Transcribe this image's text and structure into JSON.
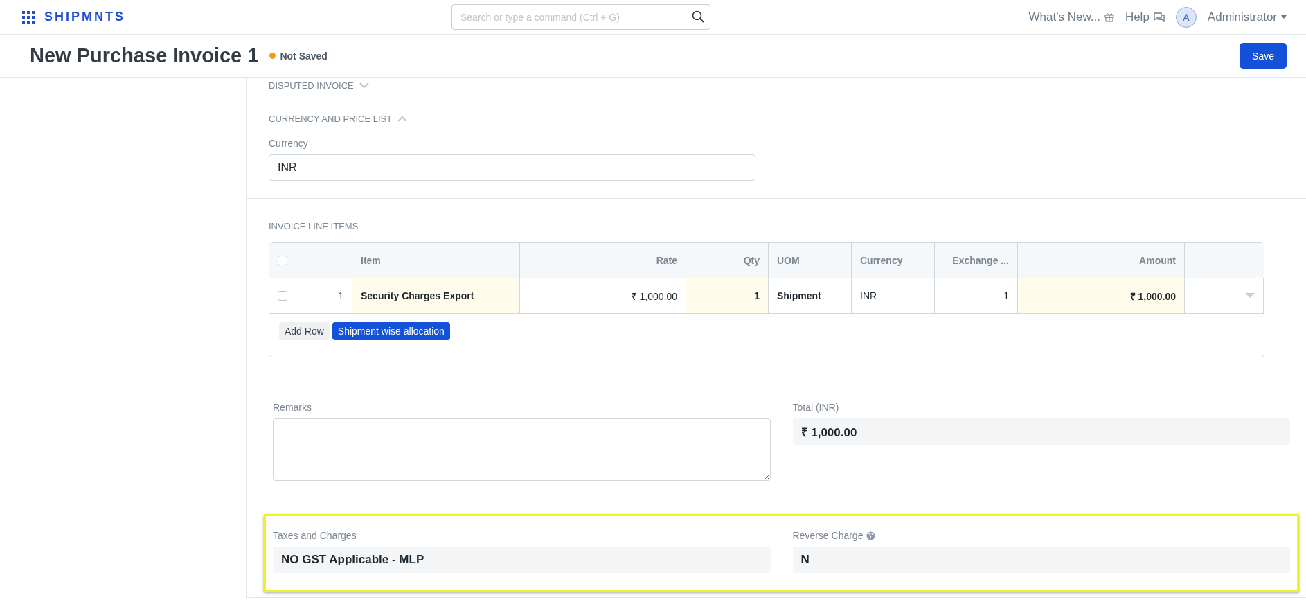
{
  "navbar": {
    "brand": "SHIPMNTS",
    "search": {
      "placeholder": "Search or type a command (Ctrl + G)"
    },
    "whats_new": "What's New...",
    "help": "Help",
    "user": {
      "initial": "A",
      "name": "Administrator"
    }
  },
  "page": {
    "title": "New Purchase Invoice 1",
    "status": "Not Saved",
    "save": "Save"
  },
  "sections": [
    {
      "kind": "collapsed",
      "title": "DISPUTED INVOICE",
      "expanded": false
    },
    {
      "kind": "currency",
      "title": "CURRENCY AND PRICE LIST",
      "expanded": true,
      "field": {
        "label": "Currency",
        "value": "INR"
      }
    },
    {
      "kind": "table",
      "title": "INVOICE LINE ITEMS",
      "header_checked": false,
      "columns": [
        {
          "kind": "check"
        },
        {
          "label": "Item",
          "kind": "link"
        },
        {
          "label": "Rate",
          "kind": "currency"
        },
        {
          "label": "Qty",
          "kind": "qty"
        },
        {
          "label": "UOM",
          "kind": "unit"
        },
        {
          "label": "Currency",
          "kind": "text"
        },
        {
          "label": "Exchange ...",
          "kind": "number"
        },
        {
          "label": "Amount",
          "kind": "amount"
        },
        {
          "kind": "menu"
        }
      ],
      "rows": [
        {
          "checked": false,
          "cells": [
            "1",
            "Security Charges Export",
            "₹ 1,000.00",
            "1",
            "Shipment",
            "INR",
            "1",
            "₹ 1,000.00"
          ]
        }
      ],
      "buttons": [
        {
          "label": "Add Row",
          "primary": false
        },
        {
          "label": "Shipment wise allocation",
          "primary": true
        }
      ]
    },
    {
      "kind": "remarks",
      "highlighted": false,
      "fields": [
        {
          "label": "Remarks",
          "kind": "textarea"
        },
        {
          "label": "Total (INR)",
          "kind": "readonly",
          "value": "₹ 1,000.00"
        }
      ]
    },
    {
      "kind": "taxes",
      "highlighted": true,
      "fields": [
        {
          "label": "Taxes and Charges",
          "kind": "readonly",
          "value": "NO GST Applicable - MLP"
        },
        {
          "label": "Reverse Charge",
          "kind": "readonly",
          "value": "N",
          "globe": true
        }
      ]
    }
  ]
}
